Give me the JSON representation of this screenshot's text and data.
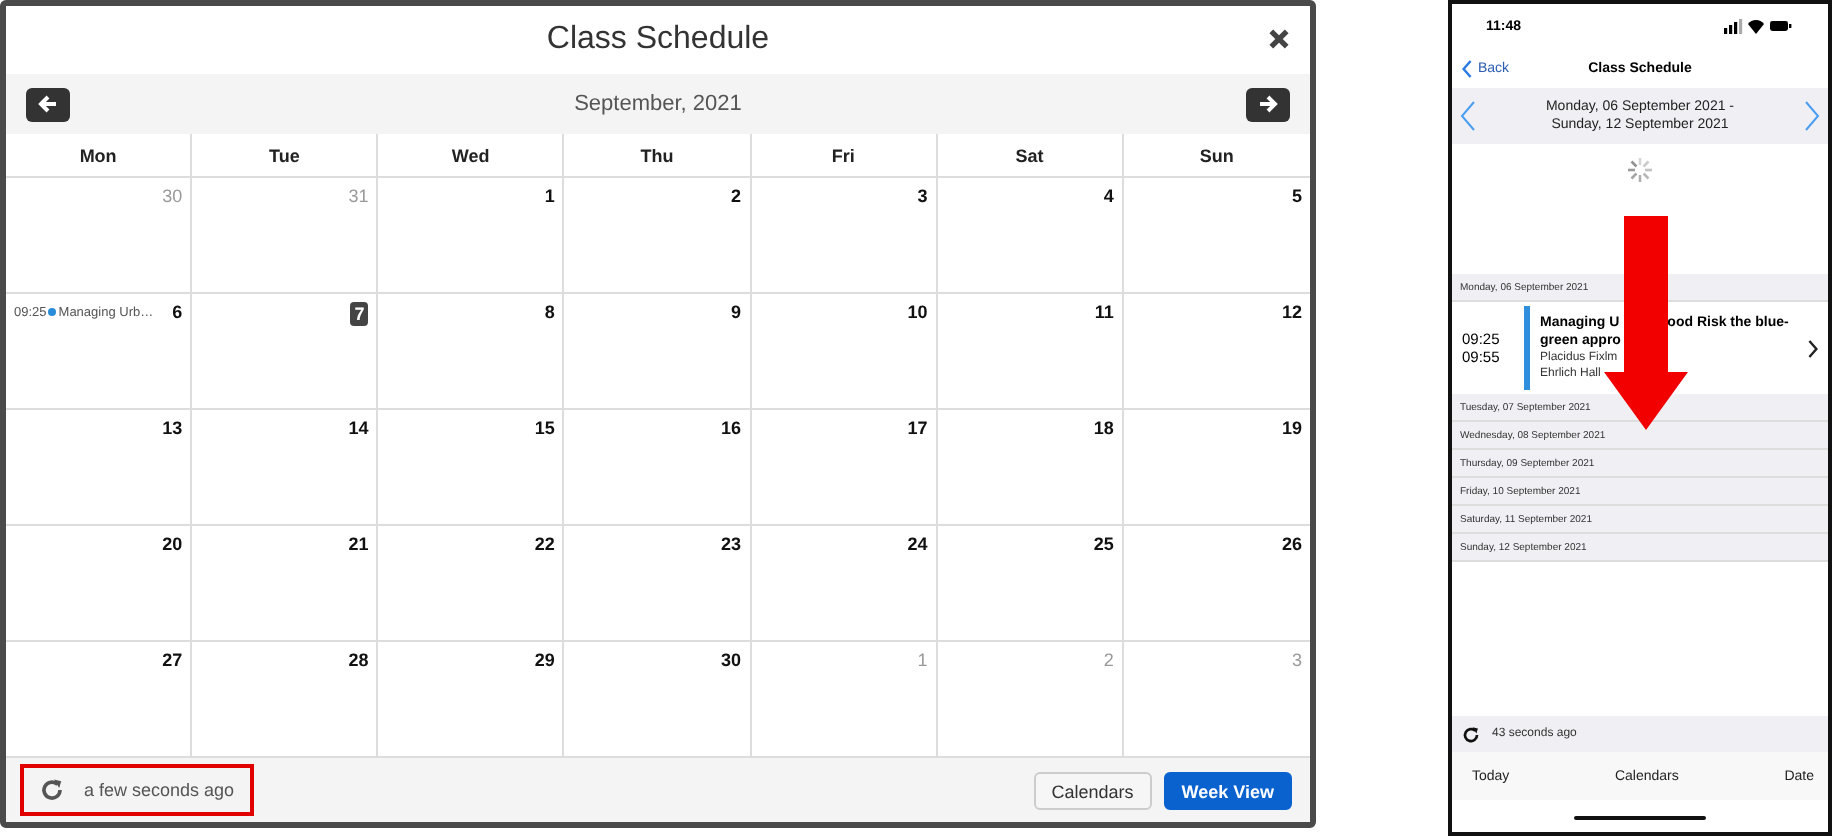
{
  "desktop": {
    "title": "Class Schedule",
    "month": "September, 2021",
    "weekdays": [
      "Mon",
      "Tue",
      "Wed",
      "Thu",
      "Fri",
      "Sat",
      "Sun"
    ],
    "weeks": [
      [
        {
          "day": "30",
          "other_month": true,
          "today": false
        },
        {
          "day": "31",
          "other_month": true,
          "today": false
        },
        {
          "day": "1",
          "other_month": false,
          "today": false
        },
        {
          "day": "2",
          "other_month": false,
          "today": false
        },
        {
          "day": "3",
          "other_month": false,
          "today": false
        },
        {
          "day": "4",
          "other_month": false,
          "today": false
        },
        {
          "day": "5",
          "other_month": false,
          "today": false
        }
      ],
      [
        {
          "day": "6",
          "other_month": false,
          "today": false,
          "events": [
            {
              "time": "09:25",
              "title": "Managing Urb…"
            }
          ]
        },
        {
          "day": "7",
          "other_month": false,
          "today": true
        },
        {
          "day": "8",
          "other_month": false,
          "today": false
        },
        {
          "day": "9",
          "other_month": false,
          "today": false
        },
        {
          "day": "10",
          "other_month": false,
          "today": false
        },
        {
          "day": "11",
          "other_month": false,
          "today": false
        },
        {
          "day": "12",
          "other_month": false,
          "today": false
        }
      ],
      [
        {
          "day": "13",
          "other_month": false,
          "today": false
        },
        {
          "day": "14",
          "other_month": false,
          "today": false
        },
        {
          "day": "15",
          "other_month": false,
          "today": false
        },
        {
          "day": "16",
          "other_month": false,
          "today": false
        },
        {
          "day": "17",
          "other_month": false,
          "today": false
        },
        {
          "day": "18",
          "other_month": false,
          "today": false
        },
        {
          "day": "19",
          "other_month": false,
          "today": false
        }
      ],
      [
        {
          "day": "20",
          "other_month": false,
          "today": false
        },
        {
          "day": "21",
          "other_month": false,
          "today": false
        },
        {
          "day": "22",
          "other_month": false,
          "today": false
        },
        {
          "day": "23",
          "other_month": false,
          "today": false
        },
        {
          "day": "24",
          "other_month": false,
          "today": false
        },
        {
          "day": "25",
          "other_month": false,
          "today": false
        },
        {
          "day": "26",
          "other_month": false,
          "today": false
        }
      ],
      [
        {
          "day": "27",
          "other_month": false,
          "today": false
        },
        {
          "day": "28",
          "other_month": false,
          "today": false
        },
        {
          "day": "29",
          "other_month": false,
          "today": false
        },
        {
          "day": "30",
          "other_month": false,
          "today": false
        },
        {
          "day": "1",
          "other_month": true,
          "today": false
        },
        {
          "day": "2",
          "other_month": true,
          "today": false
        },
        {
          "day": "3",
          "other_month": true,
          "today": false
        }
      ]
    ],
    "refresh": "a few seconds ago",
    "buttons": [
      {
        "label": "Calendars",
        "kind": "default"
      },
      {
        "label": "Week View",
        "kind": "primary"
      }
    ]
  },
  "phone": {
    "time": "11:48",
    "back": "Back",
    "title": "Class Schedule",
    "range": [
      "Monday, 06 September 2021 -",
      "Sunday, 12 September 2021"
    ],
    "days": [
      {
        "label": "Monday, 06 September 2021",
        "events": [
          {
            "start": "09:25",
            "end": "09:55",
            "title_lines": [
              [
                "Managing U",
                "ood Risk the blue-"
              ],
              [
                "green appro"
              ]
            ],
            "instructor": "Placidus Fixlm",
            "location": "Ehrlich Hall"
          }
        ]
      },
      {
        "label": "Tuesday, 07 September 2021"
      },
      {
        "label": "Wednesday, 08 September 2021"
      },
      {
        "label": "Thursday, 09 September 2021"
      },
      {
        "label": "Friday, 10 September 2021"
      },
      {
        "label": "Saturday, 11 September 2021"
      },
      {
        "label": "Sunday, 12 September 2021"
      }
    ],
    "refresh": "43 seconds ago",
    "tabs": [
      "Today",
      "Calendars",
      "Date"
    ]
  }
}
